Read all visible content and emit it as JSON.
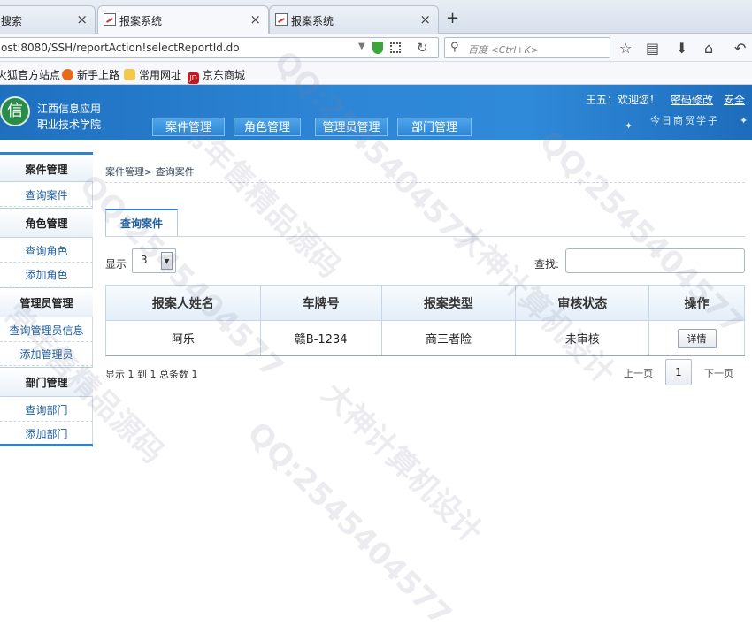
{
  "browser": {
    "tabs": [
      {
        "title": "搜索"
      },
      {
        "title": "报案系统"
      },
      {
        "title": "报案系统"
      }
    ],
    "new_tab": "+",
    "url": "ost:8080/SSH/reportAction!selectReportId.do",
    "search_placeholder": "百度 <Ctrl+K>",
    "bookmarks": [
      "火狐官方站点",
      "新手上路",
      "常用网址",
      "京东商城"
    ]
  },
  "header": {
    "school_line1": "江西信息应用",
    "school_line2": "职业技术学院",
    "logo_char": "信",
    "nav": [
      "案件管理",
      "角色管理",
      "管理员管理",
      "部门管理"
    ],
    "welcome": "王五：欢迎您！",
    "change_password": "密码修改",
    "safe": "安全",
    "motto": "今日商贸学子"
  },
  "sidebar": {
    "groups": [
      {
        "title": "案件管理",
        "items": [
          "查询案件"
        ]
      },
      {
        "title": "角色管理",
        "items": [
          "查询角色",
          "添加角色"
        ]
      },
      {
        "title": "管理员管理",
        "items": [
          "查询管理员信息",
          "添加管理员"
        ]
      },
      {
        "title": "部门管理",
        "items": [
          "查询部门",
          "添加部门"
        ]
      }
    ]
  },
  "main": {
    "breadcrumb": "案件管理> 查询案件",
    "panel_tab": "查询案件",
    "length_label": "显示",
    "length_value": "3",
    "search_label": "查找:",
    "table": {
      "columns": [
        "报案人姓名",
        "车牌号",
        "报案类型",
        "审核状态",
        "操作"
      ],
      "rows": [
        {
          "name": "阿乐",
          "plate": "赣B-1234",
          "type": "商三者险",
          "status": "未审核",
          "action": "详情"
        }
      ]
    },
    "info": "显示 1 到 1 总条数 1",
    "pager": {
      "prev": "上一页",
      "current": "1",
      "next": "下一页"
    }
  },
  "watermark": {
    "texts": [
      "常年售精品源码",
      "QQ:2545404577",
      "大神计算机设计"
    ]
  }
}
